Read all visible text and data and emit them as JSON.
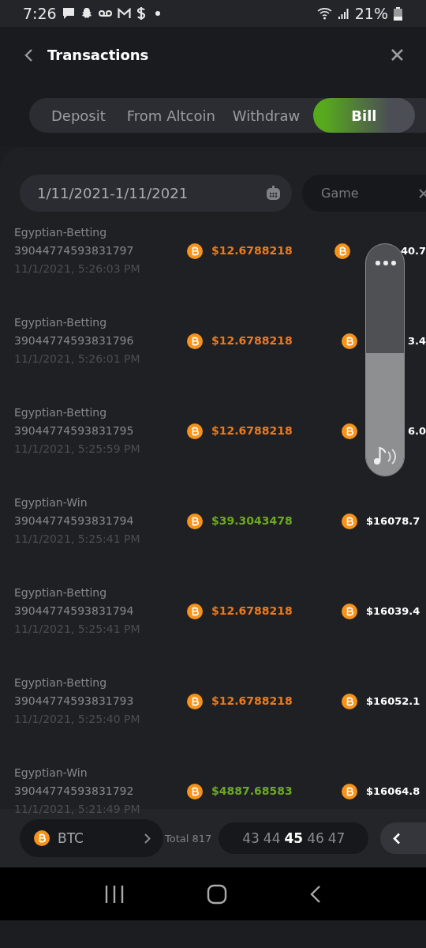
{
  "status_bar": {
    "time": "7:26",
    "battery": "21%"
  },
  "header": {
    "title": "Transactions"
  },
  "tabs": [
    {
      "label": "Deposit",
      "selected": false
    },
    {
      "label": "From Altcoin",
      "selected": false
    },
    {
      "label": "Withdraw",
      "selected": false
    },
    {
      "label": "Bill",
      "selected": true
    }
  ],
  "filters": {
    "date_range": "1/11/2021-1/11/2021",
    "game": {
      "placeholder": "Game"
    }
  },
  "rows": [
    {
      "name": "Egyptian-Betting",
      "id": "39044774593831797",
      "time": "11/1/2021, 5:26:03 PM",
      "kind": "debit",
      "amount": "$12.6788218",
      "balance": "40.7",
      "partly_covered": true
    },
    {
      "name": "Egyptian-Betting",
      "id": "39044774593831796",
      "time": "11/1/2021, 5:26:01 PM",
      "kind": "debit",
      "amount": "$12.6788218",
      "balance": "3.4",
      "partly_covered": true
    },
    {
      "name": "Egyptian-Betting",
      "id": "39044774593831795",
      "time": "11/1/2021, 5:25:59 PM",
      "kind": "debit",
      "amount": "$12.6788218",
      "balance": "6.0",
      "partly_covered": true
    },
    {
      "name": "Egyptian-Win",
      "id": "39044774593831794",
      "time": "11/1/2021, 5:25:41 PM",
      "kind": "credit",
      "amount": "$39.3043478",
      "balance": "$16078.7",
      "partly_covered": false
    },
    {
      "name": "Egyptian-Betting",
      "id": "39044774593831794",
      "time": "11/1/2021, 5:25:41 PM",
      "kind": "debit",
      "amount": "$12.6788218",
      "balance": "$16039.4",
      "partly_covered": false
    },
    {
      "name": "Egyptian-Betting",
      "id": "39044774593831793",
      "time": "11/1/2021, 5:25:40 PM",
      "kind": "debit",
      "amount": "$12.6788218",
      "balance": "$16052.1",
      "partly_covered": false
    },
    {
      "name": "Egyptian-Win",
      "id": "39044774593831792",
      "time": "11/1/2021, 5:21:49 PM",
      "kind": "credit",
      "amount": "$4887.68583",
      "balance": "$16064.8",
      "partly_covered": false
    }
  ],
  "footer": {
    "currency": "BTC",
    "total": "Total 817",
    "pages": [
      {
        "label": "43",
        "selected": false
      },
      {
        "label": "44",
        "selected": false
      },
      {
        "label": "45",
        "selected": true
      },
      {
        "label": "46",
        "selected": false
      },
      {
        "label": "47",
        "selected": false
      }
    ]
  },
  "volume_overlay": {
    "level": 0.53
  }
}
